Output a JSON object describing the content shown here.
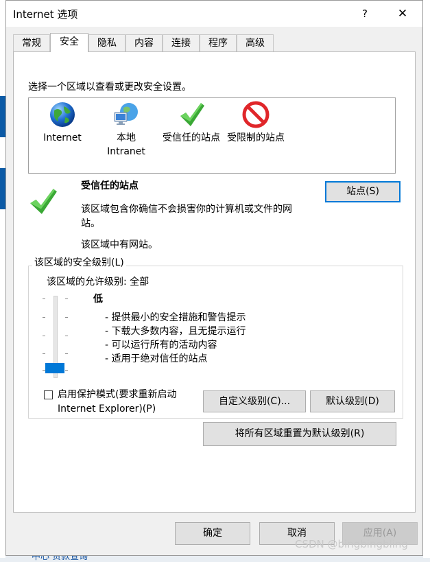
{
  "window": {
    "title": "Internet 选项",
    "help_label": "?",
    "close_label": "✕"
  },
  "tabs": [
    {
      "label": "常规"
    },
    {
      "label": "安全"
    },
    {
      "label": "隐私"
    },
    {
      "label": "内容"
    },
    {
      "label": "连接"
    },
    {
      "label": "程序"
    },
    {
      "label": "高级"
    }
  ],
  "security": {
    "instruction": "选择一个区域以查看或更改安全设置。",
    "zones": [
      {
        "label": "Internet",
        "icon": "globe-icon"
      },
      {
        "label": "本地\nIntranet",
        "label_line1": "本地",
        "label_line2": "Intranet",
        "icon": "network-icon"
      },
      {
        "label": "受信任的站点",
        "icon": "checkmark-icon"
      },
      {
        "label": "受限制的站点",
        "icon": "restricted-icon"
      }
    ],
    "selected_zone": {
      "title": "受信任的站点",
      "description": "该区域包含你确信不会损害你的计算机或文件的网站。",
      "description_line1": "该区域包含你确信不会损害你的计算机或文件的网",
      "description_line2": "站。",
      "status": "该区域中有网站。",
      "sites_button": "站点(S)"
    },
    "level_group": {
      "label": "该区域的安全级别(L)",
      "allowed": "该区域的允许级别: 全部",
      "level_name": "低",
      "bullets": [
        "- 提供最小的安全措施和警告提示",
        "- 下载大多数内容，且无提示运行",
        "- 可以运行所有的活动内容",
        "- 适用于绝对信任的站点"
      ],
      "slider_level": "低",
      "protected_mode_line1": "启用保护模式(要求重新启动",
      "protected_mode_line2": "Internet Explorer)(P)",
      "protected_mode_checked": false,
      "custom_button": "自定义级别(C)...",
      "default_button": "默认级别(D)"
    },
    "reset_all_button": "将所有区域重置为默认级别(R)"
  },
  "footer": {
    "ok": "确定",
    "cancel": "取消",
    "apply": "应用(A)"
  },
  "background": {
    "bottom_text": "中心  贷款查询"
  },
  "watermark": "CSDN @bingbingbling",
  "colors": {
    "accent": "#0078d7",
    "slider_thumb": "#0078d7",
    "check_green": "#3aa835",
    "restricted_red": "#e0262a"
  }
}
